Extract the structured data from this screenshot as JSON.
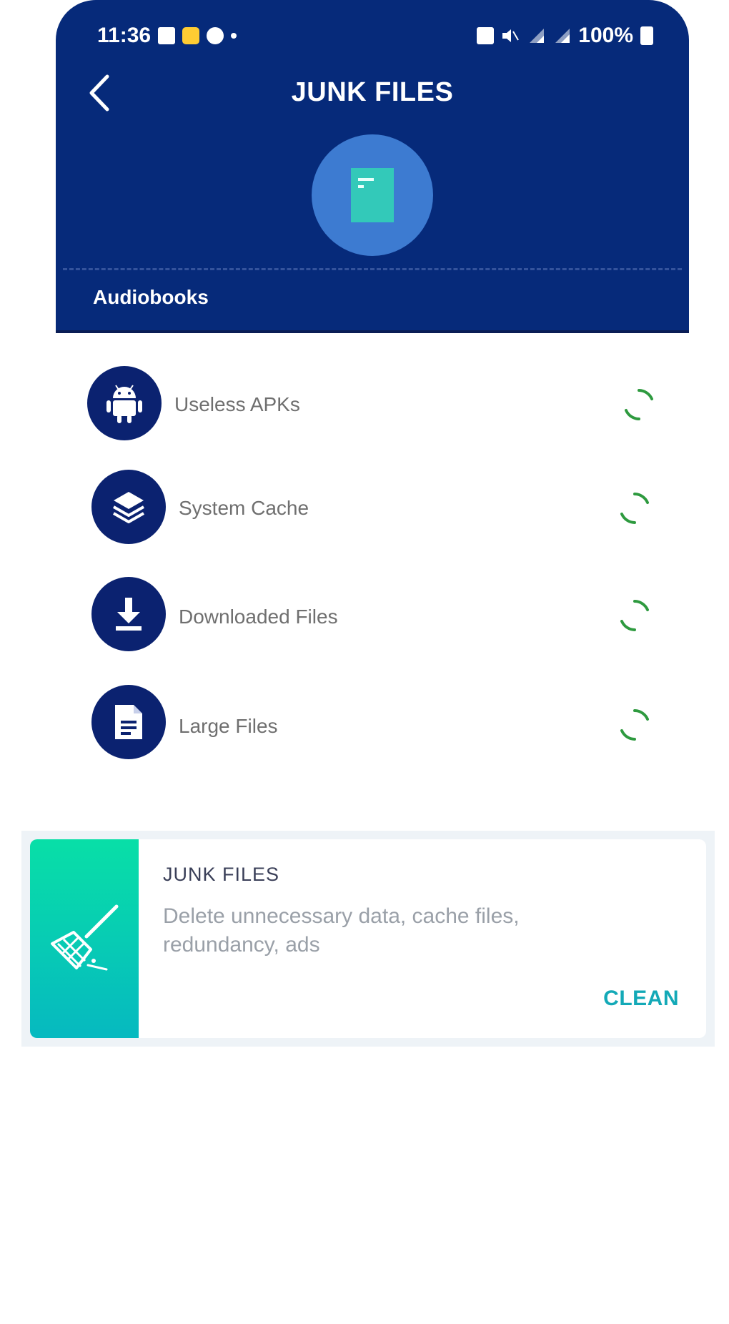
{
  "status_bar": {
    "time": "11:36",
    "battery": "100%"
  },
  "header": {
    "title": "JUNK FILES",
    "category": "Audiobooks"
  },
  "scan_items": [
    {
      "label": "Useless APKs",
      "icon": "android-icon"
    },
    {
      "label": "System Cache",
      "icon": "layers-icon"
    },
    {
      "label": "Downloaded Files",
      "icon": "download-icon"
    },
    {
      "label": "Large Files",
      "icon": "document-icon"
    }
  ],
  "card": {
    "title": "JUNK FILES",
    "description": "Delete unnecessary data, cache files, redundancy, ads",
    "action": "CLEAN"
  },
  "colors": {
    "header_bg": "#062a7a",
    "icon_bg": "#0b2270",
    "spinner": "#2e9a3f",
    "card_gradient_top": "#08dfa7",
    "card_gradient_bottom": "#06b9c0",
    "action": "#13a9b7"
  }
}
